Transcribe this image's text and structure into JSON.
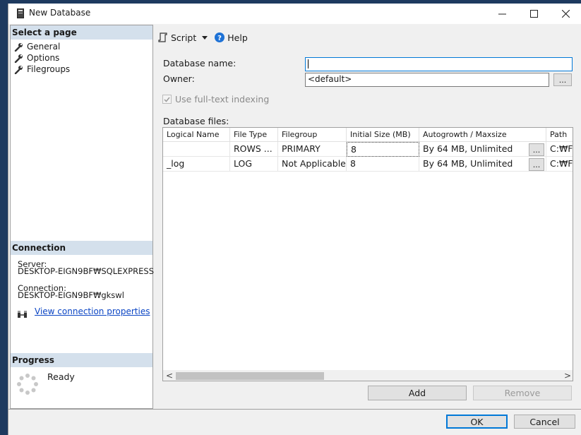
{
  "window": {
    "title": "New Database",
    "controls": {
      "minimize": "─",
      "maximize": "☐",
      "close": "✕"
    }
  },
  "left_panel": {
    "select_page": {
      "title": "Select a page",
      "items": [
        {
          "label": "General",
          "icon": "wrench-icon"
        },
        {
          "label": "Options",
          "icon": "wrench-icon"
        },
        {
          "label": "Filegroups",
          "icon": "wrench-icon"
        }
      ]
    },
    "connection": {
      "title": "Connection",
      "server_label": "Server:",
      "server_value": "DESKTOP-EIGN9BF₩SQLEXPRESS",
      "connection_label": "Connection:",
      "connection_value": "DESKTOP-EIGN9BF₩gkswl",
      "view_properties": "View connection properties"
    },
    "progress": {
      "title": "Progress",
      "status": "Ready"
    }
  },
  "toolbar": {
    "script_label": "Script",
    "help_label": "Help"
  },
  "form": {
    "db_name_label": "Database name:",
    "db_name_value": "",
    "owner_label": "Owner:",
    "owner_value": "<default>",
    "browse_label": "...",
    "fulltext_label": "Use full-text indexing",
    "fulltext_checked": true,
    "files_label": "Database files:"
  },
  "files_grid": {
    "columns": [
      "Logical Name",
      "File Type",
      "Filegroup",
      "Initial Size (MB)",
      "Autogrowth / Maxsize",
      "Path"
    ],
    "rows": [
      {
        "logical_name": "",
        "file_type": "ROWS ...",
        "filegroup": "PRIMARY",
        "initial_size": "8",
        "autogrowth": "By 64 MB, Unlimited",
        "button": "...",
        "path": "C:₩F"
      },
      {
        "logical_name": "_log",
        "file_type": "LOG",
        "filegroup": "Not Applicable",
        "initial_size": "8",
        "autogrowth": "By 64 MB, Unlimited",
        "button": "...",
        "path": "C:₩F"
      }
    ],
    "scroll_left": "<",
    "scroll_right": ">"
  },
  "grid_buttons": {
    "add": "Add",
    "remove": "Remove"
  },
  "dialog_buttons": {
    "ok": "OK",
    "cancel": "Cancel"
  },
  "colors": {
    "section_header_bg": "#d4e0ec",
    "link": "#0b45c4",
    "ok_border": "#0078d7"
  }
}
